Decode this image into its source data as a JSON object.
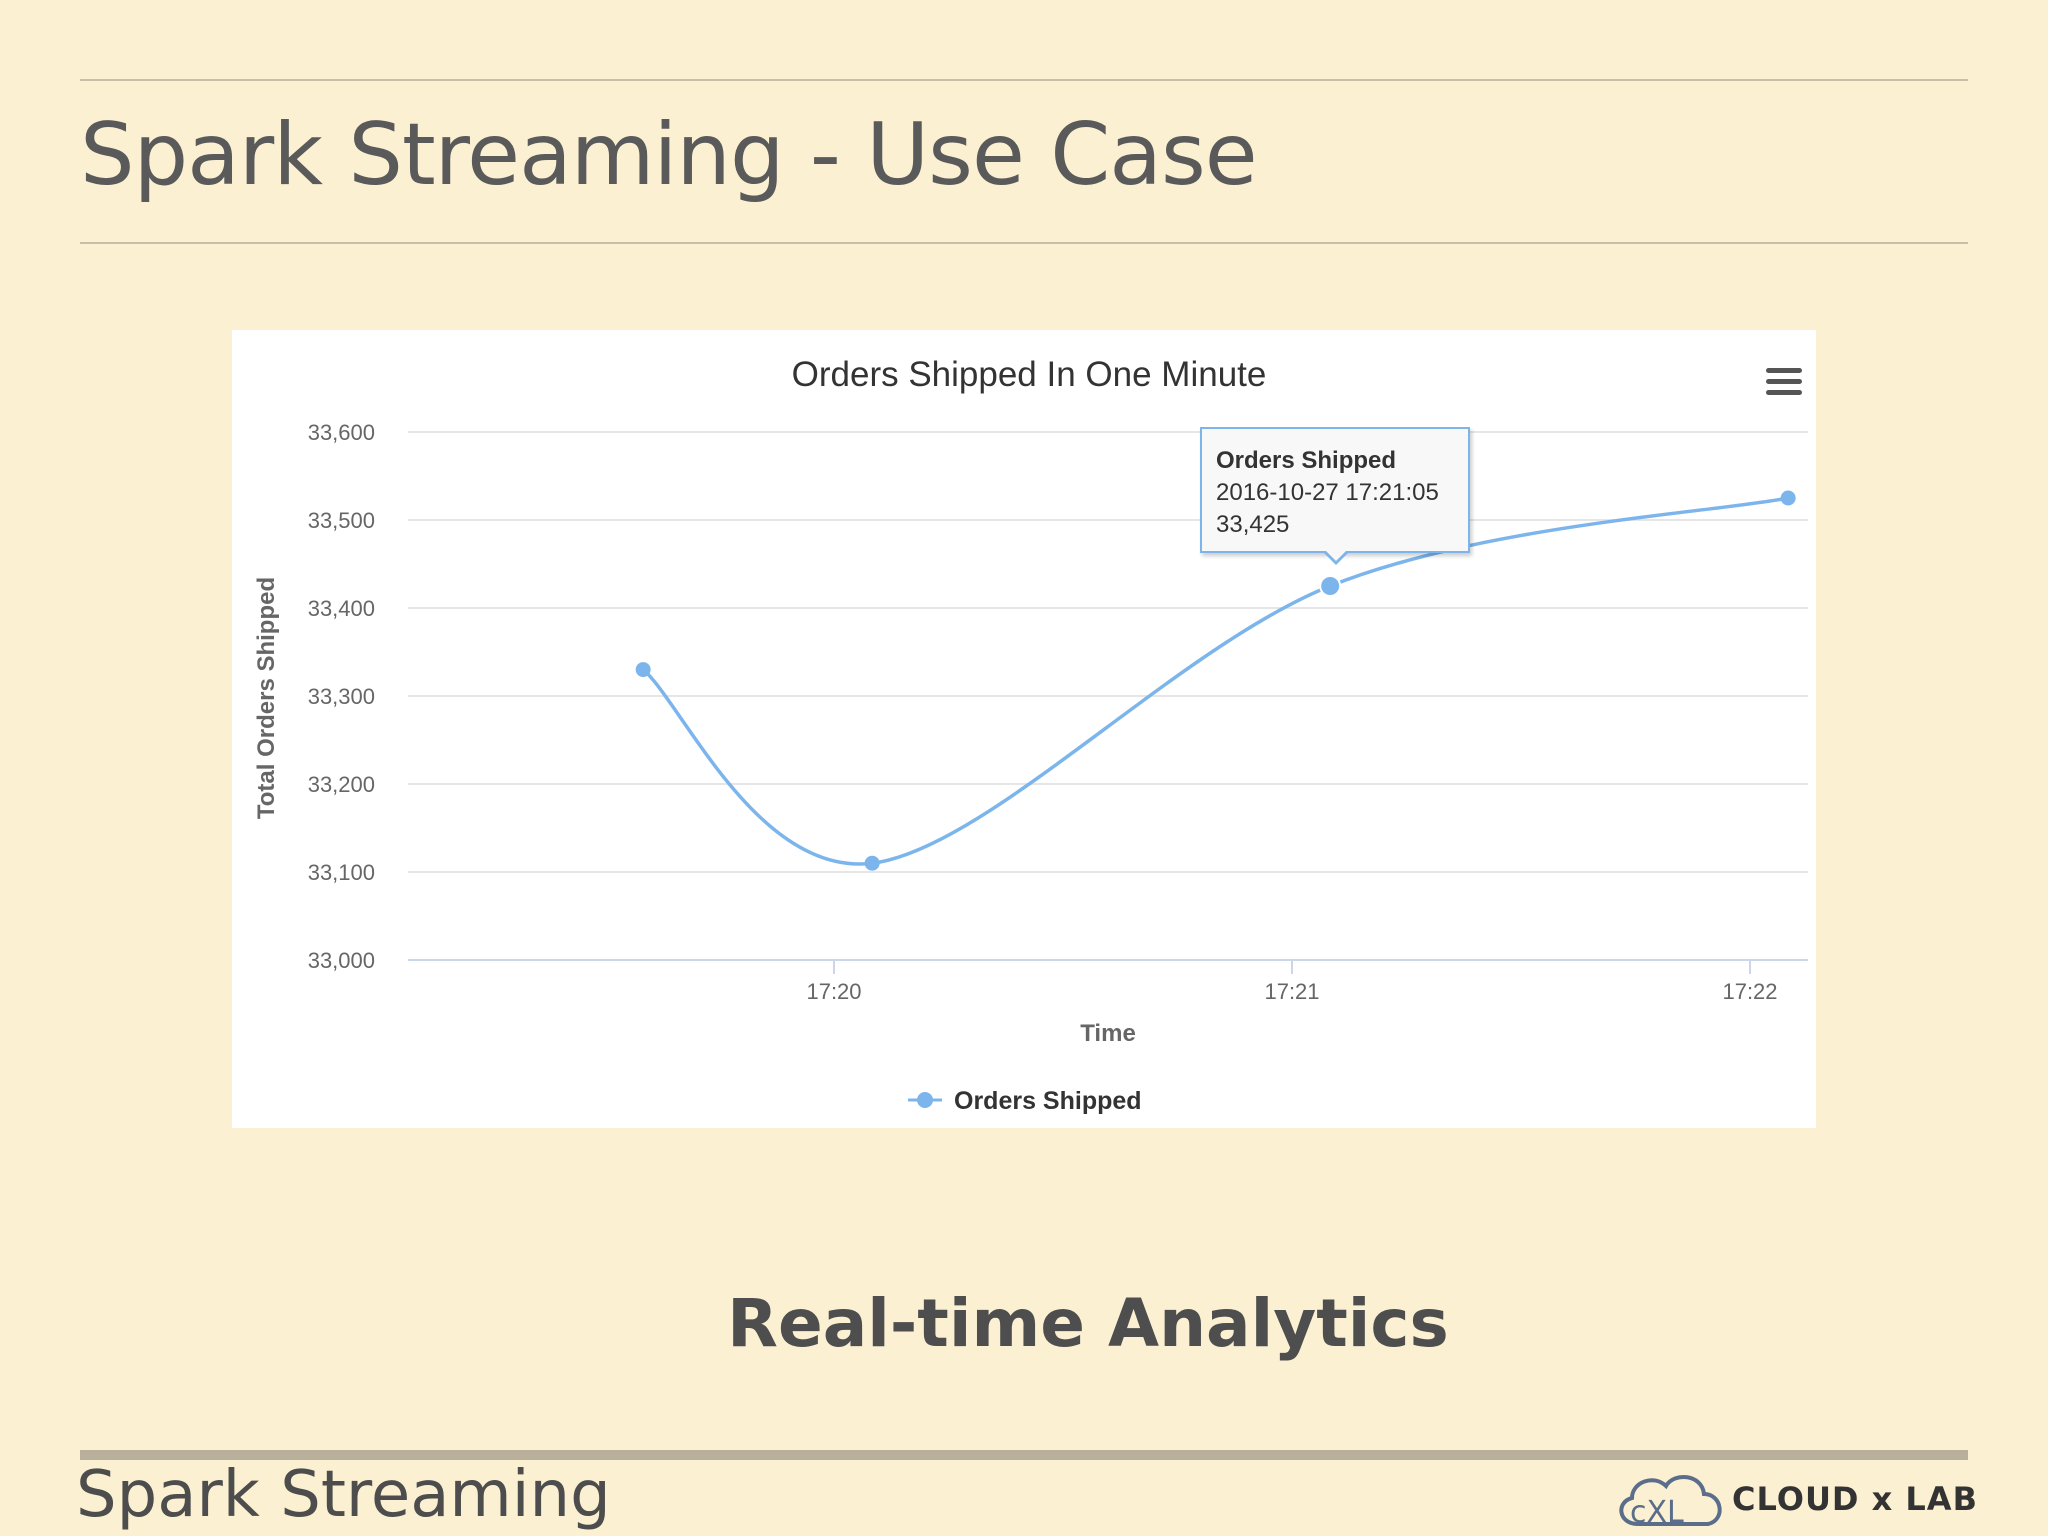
{
  "slide": {
    "title": "Spark Streaming - Use Case",
    "subtitle": "Real-time Analytics",
    "footer_title": "Spark Streaming",
    "logo_text": "CLOUD x LAB"
  },
  "colors": {
    "series": "#7cb5ec",
    "background": "#fbf0d2"
  },
  "menu_icon": "hamburger-menu-icon",
  "tooltip": {
    "title": "Orders Shipped",
    "date": "2016-10-27 17:21:05",
    "value": "33,425"
  },
  "chart_data": {
    "type": "line",
    "title": "Orders Shipped In One Minute",
    "xlabel": "Time",
    "ylabel": "Total Orders Shipped",
    "ylim": [
      33000,
      33600
    ],
    "yticks": [
      "33,000",
      "33,100",
      "33,200",
      "33,300",
      "33,400",
      "33,500",
      "33,600"
    ],
    "xticks": [
      "17:20",
      "17:21",
      "17:22"
    ],
    "grid": true,
    "legend": "bottom-center",
    "series": [
      {
        "name": "Orders Shipped",
        "x": [
          "17:19:35",
          "17:20:05",
          "17:21:05",
          "17:22:05"
        ],
        "values": [
          33330,
          33110,
          33425,
          33525
        ]
      }
    ]
  }
}
